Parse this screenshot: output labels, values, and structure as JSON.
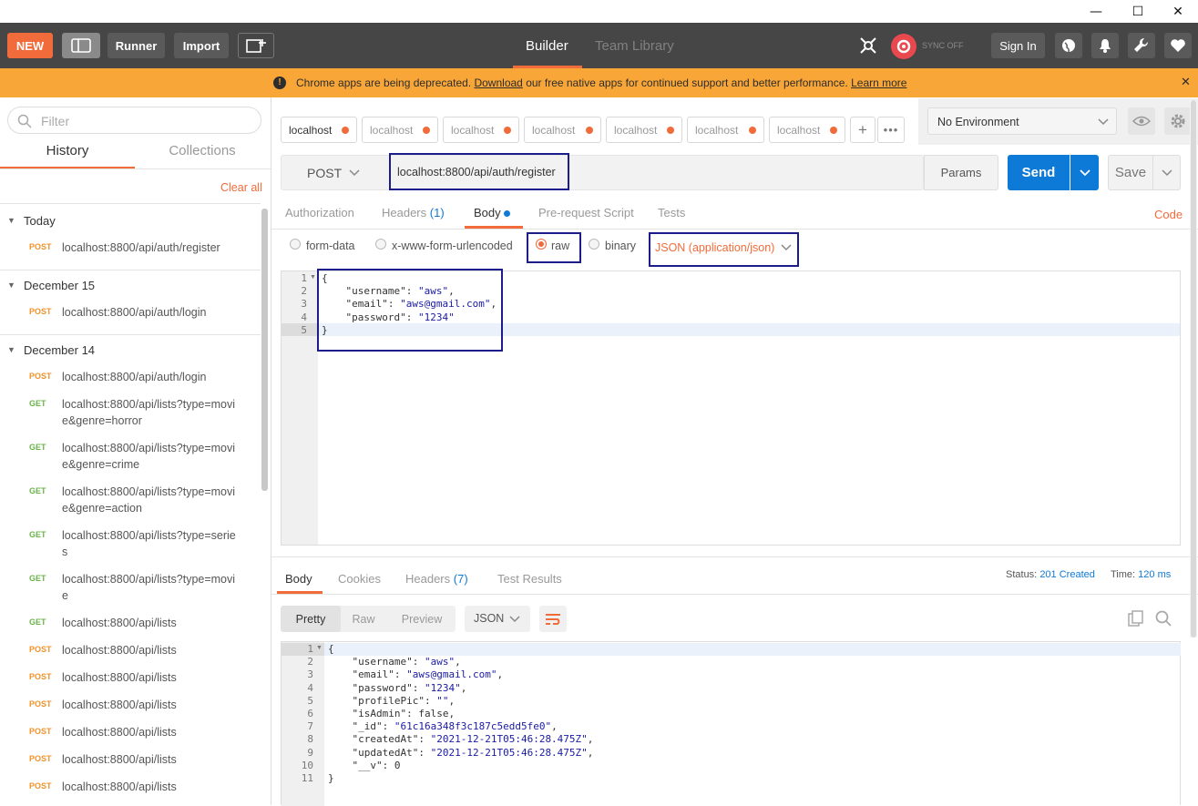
{
  "window": {
    "minimize": "—",
    "maximize": "☐",
    "close": "✕"
  },
  "toolbar": {
    "new_label": "NEW",
    "runner_label": "Runner",
    "import_label": "Import",
    "tabs": [
      "Builder",
      "Team Library"
    ],
    "sync_label": "SYNC OFF",
    "signin_label": "Sign In",
    "accent": "#f26b3a"
  },
  "banner": {
    "icon": "!",
    "text_before": "Chrome apps are being deprecated.",
    "download_link": "Download",
    "text_after": "our free native apps for continued support and better performance.",
    "learn_link": "Learn more",
    "close": "✕"
  },
  "sidebar": {
    "filter_placeholder": "Filter",
    "tabs": [
      "History",
      "Collections"
    ],
    "clear_all": "Clear all",
    "groups": [
      {
        "title": "Today",
        "items": [
          {
            "method": "POST",
            "url": "localhost:8800/api/auth/register"
          }
        ]
      },
      {
        "title": "December 15",
        "items": [
          {
            "method": "POST",
            "url": "localhost:8800/api/auth/login"
          }
        ]
      },
      {
        "title": "December 14",
        "items": [
          {
            "method": "POST",
            "url": "localhost:8800/api/auth/login"
          },
          {
            "method": "GET",
            "url": "localhost:8800/api/lists?type=movie&genre=horror"
          },
          {
            "method": "GET",
            "url": "localhost:8800/api/lists?type=movie&genre=crime"
          },
          {
            "method": "GET",
            "url": "localhost:8800/api/lists?type=movie&genre=action"
          },
          {
            "method": "GET",
            "url": "localhost:8800/api/lists?type=series"
          },
          {
            "method": "GET",
            "url": "localhost:8800/api/lists?type=movie"
          },
          {
            "method": "GET",
            "url": "localhost:8800/api/lists"
          },
          {
            "method": "POST",
            "url": "localhost:8800/api/lists"
          },
          {
            "method": "POST",
            "url": "localhost:8800/api/lists"
          },
          {
            "method": "POST",
            "url": "localhost:8800/api/lists"
          },
          {
            "method": "POST",
            "url": "localhost:8800/api/lists"
          },
          {
            "method": "POST",
            "url": "localhost:8800/api/lists"
          },
          {
            "method": "POST",
            "url": "localhost:8800/api/lists"
          }
        ]
      }
    ]
  },
  "request_tabs": [
    "localhost",
    "localhost",
    "localhost",
    "localhost",
    "localhost",
    "localhost",
    "localhost"
  ],
  "environment": {
    "selected": "No Environment"
  },
  "request": {
    "method": "POST",
    "url": "localhost:8800/api/auth/register",
    "params_label": "Params",
    "send_label": "Send",
    "save_label": "Save"
  },
  "request_subtabs": {
    "authorization": "Authorization",
    "headers": "Headers",
    "headers_count": "(1)",
    "body": "Body",
    "prescript": "Pre-request Script",
    "tests": "Tests",
    "code": "Code"
  },
  "body_modes": {
    "form_data": "form-data",
    "urlencoded": "x-www-form-urlencoded",
    "raw": "raw",
    "binary": "binary",
    "content_type": "JSON (application/json)"
  },
  "request_body": {
    "lines": [
      "{",
      "    \"username\": \"aws\",",
      "    \"email\": \"aws@gmail.com\",",
      "    \"password\": \"1234\"",
      "}"
    ]
  },
  "response": {
    "tabs": {
      "body": "Body",
      "cookies": "Cookies",
      "headers": "Headers",
      "headers_count": "(7)",
      "test_results": "Test Results"
    },
    "status_label": "Status:",
    "status_value": "201 Created",
    "time_label": "Time:",
    "time_value": "120 ms",
    "views": [
      "Pretty",
      "Raw",
      "Preview"
    ],
    "format": "JSON",
    "lines": [
      "{",
      "    \"username\": \"aws\",",
      "    \"email\": \"aws@gmail.com\",",
      "    \"password\": \"1234\",",
      "    \"profilePic\": \"\",",
      "    \"isAdmin\": false,",
      "    \"_id\": \"61c16a348f3c187c5edd5fe0\",",
      "    \"createdAt\": \"2021-12-21T05:46:28.475Z\",",
      "    \"updatedAt\": \"2021-12-21T05:46:28.475Z\",",
      "    \"__v\": 0",
      "}"
    ]
  }
}
